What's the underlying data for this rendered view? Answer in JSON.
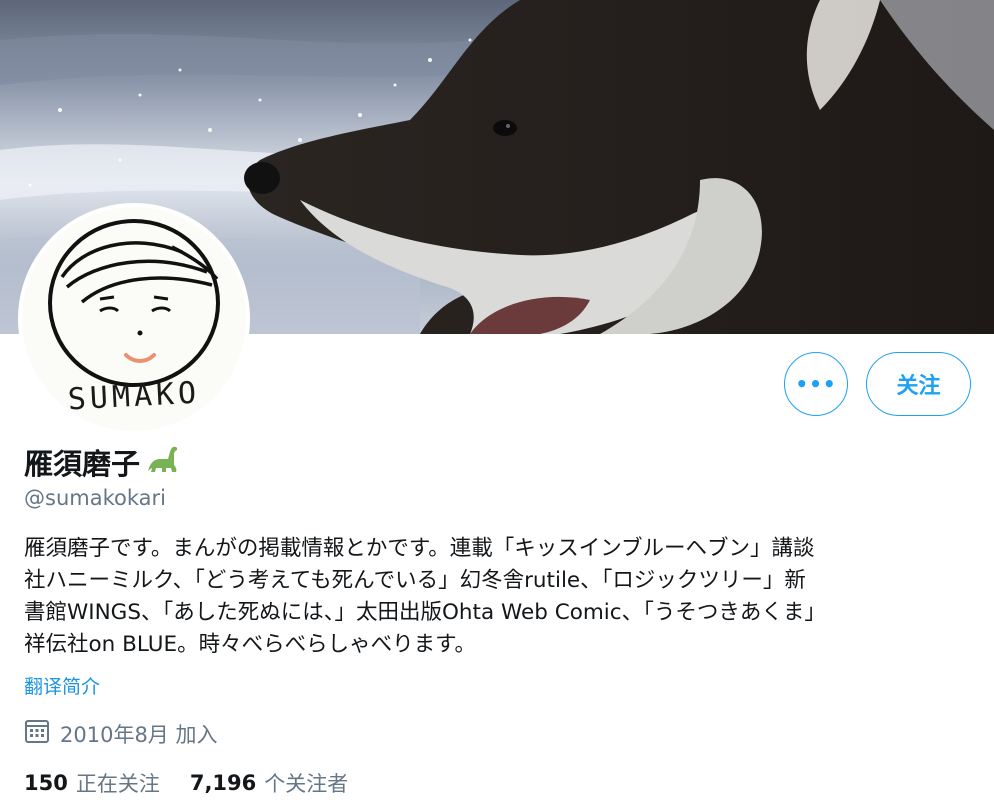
{
  "profile": {
    "display_name": "雁須磨子",
    "name_emoji": "🦕",
    "handle": "@sumakokari",
    "avatar_signature": "SUMAKO",
    "bio_lines": [
      "雁須磨子です。まんがの掲載情報とかです。連載「キッスインブルーヘブン」講談",
      "社ハニーミルク、「どう考えても死んでいる」幻冬舎rutile、「ロジックツリー」新",
      "書館WINGS、「あした死ぬには、」太田出版Ohta Web Comic、「うそつきあくま」",
      "祥伝社on BLUE。時々べらべらしゃべります。"
    ],
    "translate_label": "翻译简介",
    "joined_text": "2010年8月 加入",
    "following_count": "150",
    "following_label": "正在关注",
    "followers_count": "7,196",
    "followers_label": "个关注者"
  },
  "actions": {
    "more_label": "•••",
    "follow_label": "关注"
  },
  "colors": {
    "accent": "#1da1f2",
    "link": "#1b95e0",
    "secondary_text": "#657786",
    "primary_text": "#14171a"
  }
}
